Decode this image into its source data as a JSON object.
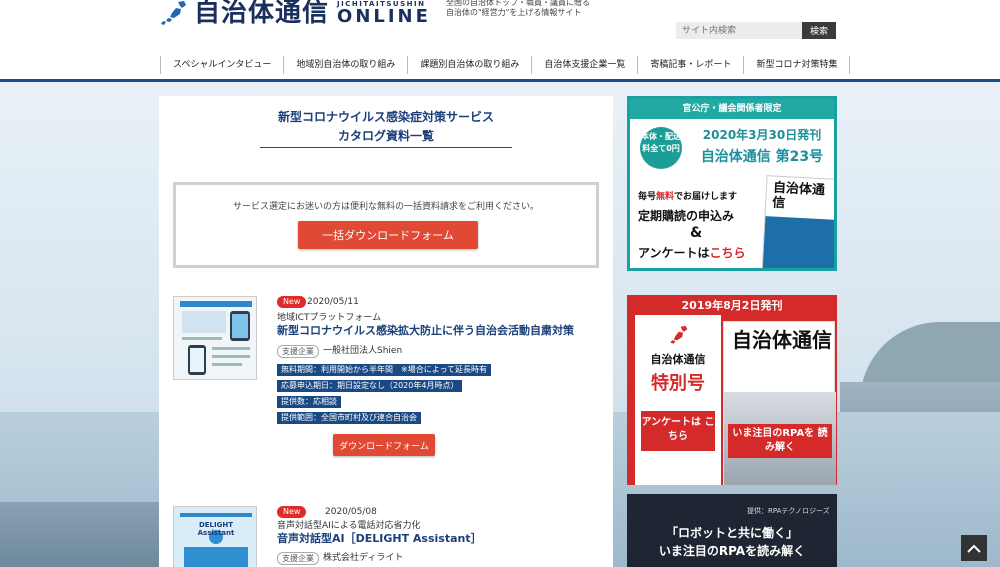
{
  "header": {
    "logo_main": "自治体通信",
    "logo_roman": "JICHITAITSUSHIN",
    "logo_online": "ONLINE",
    "tagline_line1": "全国の自治体トップ・職員・議員に贈る",
    "tagline_line2": "自治体の\"経営力\"を上げる情報サイト",
    "search_placeholder": "サイト内検索",
    "search_button": "検索",
    "nav": [
      "スペシャルインタビュー",
      "地域別自治体の取り組み",
      "課題別自治体の取り組み",
      "自治体支援企業一覧",
      "寄稿記事・レポート",
      "新型コロナ対策特集"
    ]
  },
  "main": {
    "title_line1": "新型コロナウイルス感染症対策サービス",
    "title_line2": "カタログ資料一覧",
    "notice_text": "サービス選定にお迷いの方は便利な無料の一括資料請求をご利用ください。",
    "bulk_button": "一括ダウンロードフォーム",
    "entries": [
      {
        "badge": "New",
        "date": "2020/05/11",
        "category": "地域ICTプラットフォーム",
        "title": "新型コロナウイルス感染拡大防止に伴う自治会活動自粛対策",
        "company_tag": "支援企業",
        "company": "一般社団法人Shien",
        "details": [
          "無料期間：利用開始から半年間　※場合によって延長時有",
          "応募申込期日：期日設定なし（2020年4月時点）",
          "提供数：応相談",
          "提供範囲：全国市町村及び連合自治会"
        ],
        "button": "ダウンロードフォーム"
      },
      {
        "badge": "New",
        "date": "2020/05/08",
        "category": "音声対話型AIによる電話対応省力化",
        "title": "音声対話型AI［DELIGHT Assistant］",
        "company_tag": "支援企業",
        "company": "株式会社ディライト",
        "thumb_text_1": "DELIGHT",
        "thumb_text_2": "Assistant"
      }
    ]
  },
  "sidebar": {
    "banner1": {
      "head": "官公庁・議会関係者限定",
      "circle": "本体・配送料全て0円",
      "date": "2020年3月30日発刊",
      "issue": "自治体通信 第23号",
      "free_prefix": "毎号",
      "free_highlight": "無料",
      "free_suffix": "でお届けします",
      "subscribe": "定期購読の申込み",
      "amp": "&",
      "survey_prefix": "アンケートは",
      "survey_highlight": "こちら",
      "magazine_title": "自治体通信"
    },
    "banner2": {
      "date": "2019年8月2日発刊",
      "name": "自治体通信",
      "special": "特別号",
      "survey": "アンケートは こちら",
      "magazine_title": "自治体通信",
      "rpa": "いま注目のRPAを 読み解く"
    },
    "banner3": {
      "tag": "提供：RPAテクノロジーズ",
      "line1": "「ロボットと共に働く」",
      "line2": "いま注目のRPAを読み解く"
    }
  },
  "to_top_icon": "chevron-up-icon",
  "colors": {
    "brand_navy": "#1b2f5e",
    "accent_red": "#e04a35",
    "detail_blue": "#1a4a85",
    "teal": "#23a9a3"
  }
}
